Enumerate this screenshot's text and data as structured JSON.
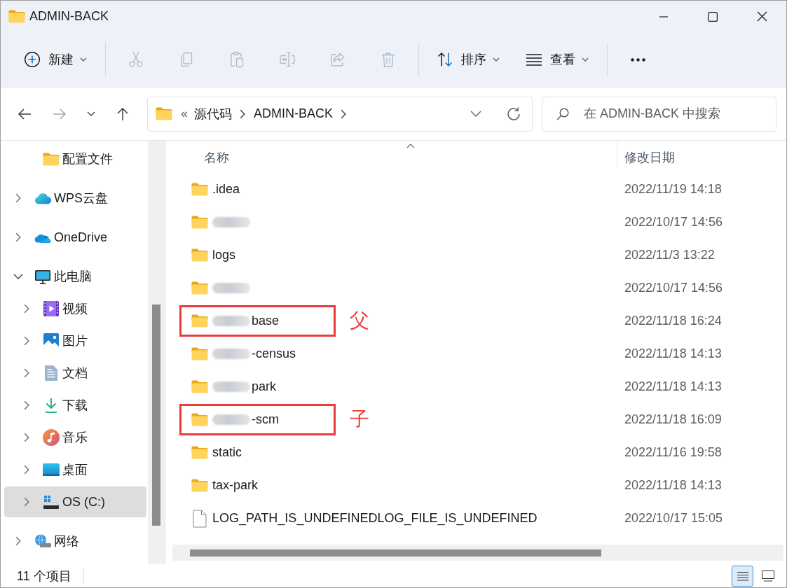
{
  "window": {
    "title": "ADMIN-BACK"
  },
  "toolbar": {
    "groups": [
      {
        "items": [
          {
            "kind": "new",
            "label": "新建",
            "menu": true,
            "disabled": false
          }
        ]
      },
      {
        "items": [
          {
            "kind": "cut",
            "disabled": true
          },
          {
            "kind": "copy",
            "disabled": true
          },
          {
            "kind": "paste",
            "disabled": true
          },
          {
            "kind": "rename",
            "disabled": true
          },
          {
            "kind": "share",
            "disabled": true
          },
          {
            "kind": "delete",
            "disabled": true
          }
        ]
      },
      {
        "items": [
          {
            "kind": "sort",
            "label": "排序",
            "menu": true,
            "disabled": false
          },
          {
            "kind": "view",
            "label": "查看",
            "menu": true,
            "disabled": false
          }
        ]
      },
      {
        "items": [
          {
            "kind": "more",
            "disabled": false
          }
        ]
      }
    ]
  },
  "navigation": {
    "buttons": [
      {
        "kind": "back",
        "disabled": false
      },
      {
        "kind": "forward",
        "disabled": true
      },
      {
        "kind": "recent",
        "disabled": false
      },
      {
        "kind": "up",
        "disabled": false
      }
    ],
    "address": {
      "overflow": "«",
      "crumbs": [
        "源代码",
        "ADMIN-BACK"
      ]
    },
    "search": {
      "placeholder": "在 ADMIN-BACK 中搜索"
    }
  },
  "sidebar": {
    "items": [
      {
        "children": [
          {
            "kind": "folder",
            "label": "配置文件",
            "selected": false
          }
        ]
      },
      {
        "kind": "wps-cloud",
        "label": "WPS云盘",
        "expanded": false,
        "selected": false
      },
      {
        "kind": "onedrive",
        "label": "OneDrive",
        "expanded": false,
        "selected": false
      },
      {
        "kind": "computer",
        "label": "此电脑",
        "expanded": true,
        "selected": false,
        "children": [
          {
            "kind": "videos",
            "label": "视频",
            "expanded": false,
            "selected": false
          },
          {
            "kind": "pictures",
            "label": "图片",
            "expanded": false,
            "selected": false
          },
          {
            "kind": "documents",
            "label": "文档",
            "expanded": false,
            "selected": false
          },
          {
            "kind": "downloads",
            "label": "下载",
            "expanded": false,
            "selected": false
          },
          {
            "kind": "music",
            "label": "音乐",
            "expanded": false,
            "selected": false
          },
          {
            "kind": "desktop",
            "label": "桌面",
            "expanded": false,
            "selected": false
          },
          {
            "kind": "drive",
            "label": "OS (C:)",
            "expanded": false,
            "selected": true
          }
        ]
      },
      {
        "kind": "network",
        "label": "网络",
        "expanded": false,
        "selected": false
      }
    ]
  },
  "file_list": {
    "columns": [
      {
        "label": "名称",
        "sorted": true
      },
      {
        "label": "修改日期",
        "sorted": false
      }
    ],
    "rows": [
      {
        "kind": "folder",
        "name": ".idea",
        "blurred": false,
        "date": "2022/11/19 14:18"
      },
      {
        "kind": "folder",
        "blurred": true,
        "date": "2022/10/17 14:56"
      },
      {
        "kind": "folder",
        "name": "logs",
        "blurred": false,
        "date": "2022/11/3 13:22"
      },
      {
        "kind": "folder",
        "blurred": true,
        "date": "2022/10/17 14:56"
      },
      {
        "kind": "folder",
        "name": "base",
        "blurred": true,
        "date": "2022/11/18 16:24",
        "annotation": {
          "label": "父"
        }
      },
      {
        "kind": "folder",
        "name": "-census",
        "blurred": true,
        "date": "2022/11/18 14:13"
      },
      {
        "kind": "folder",
        "name": "park",
        "blurred": true,
        "date": "2022/11/18 14:13"
      },
      {
        "kind": "folder",
        "name": "-scm",
        "blurred": true,
        "date": "2022/11/18 16:09",
        "annotation": {
          "label": "子"
        }
      },
      {
        "kind": "folder",
        "name": "static",
        "blurred": false,
        "date": "2022/11/16 19:58"
      },
      {
        "kind": "folder",
        "name": "tax-park",
        "blurred": false,
        "date": "2022/11/18 14:13"
      },
      {
        "kind": "file",
        "name": "LOG_PATH_IS_UNDEFINEDLOG_FILE_IS_UNDEFINED",
        "blurred": false,
        "date": "2022/10/17 15:05"
      }
    ]
  },
  "status_bar": {
    "item_count": "11 个项目",
    "views": [
      {
        "kind": "details",
        "selected": true
      },
      {
        "kind": "tiles",
        "selected": false
      }
    ]
  }
}
